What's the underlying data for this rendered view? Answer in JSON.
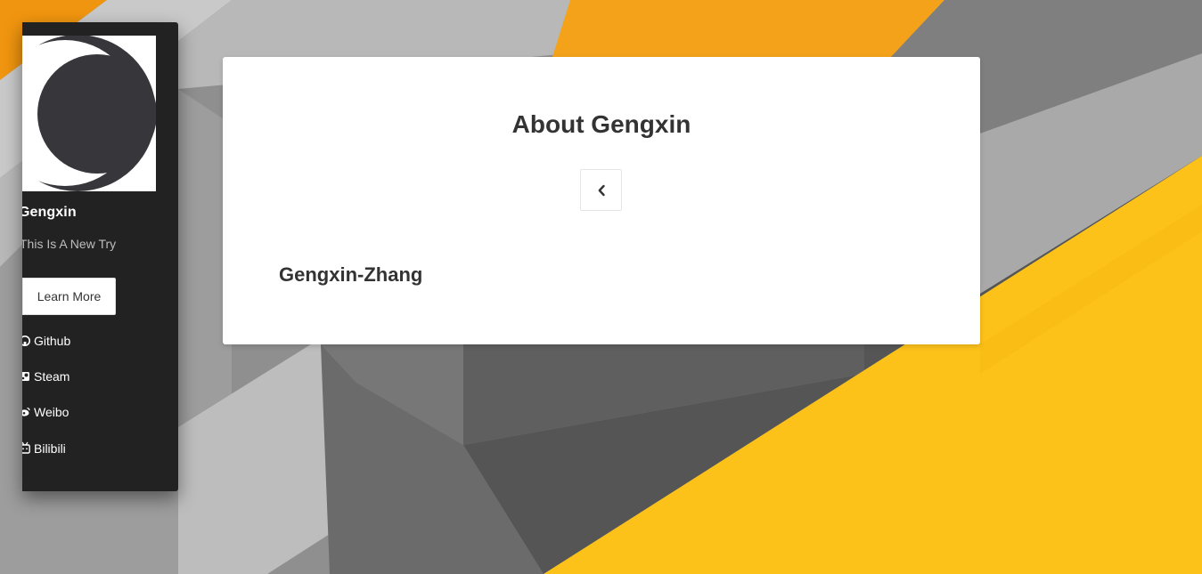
{
  "sidebar": {
    "site_name": "Gengxin",
    "description": "This Is A New Try",
    "learn_more_label": "Learn More",
    "links": [
      {
        "label": "Github",
        "icon": "github-icon"
      },
      {
        "label": "Steam",
        "icon": "steam-icon"
      },
      {
        "label": "Weibo",
        "icon": "weibo-icon"
      },
      {
        "label": "Bilibili",
        "icon": "bilibili-icon"
      }
    ]
  },
  "main": {
    "title": "About Gengxin",
    "back_icon": "chevron-left-icon",
    "author": "Gengxin-Zhang"
  },
  "colors": {
    "sidebar_bg": "#222222",
    "card_bg": "#ffffff",
    "accent_orange": "#f39c12",
    "accent_yellow": "#fbc02d",
    "text_dark": "#333333"
  }
}
